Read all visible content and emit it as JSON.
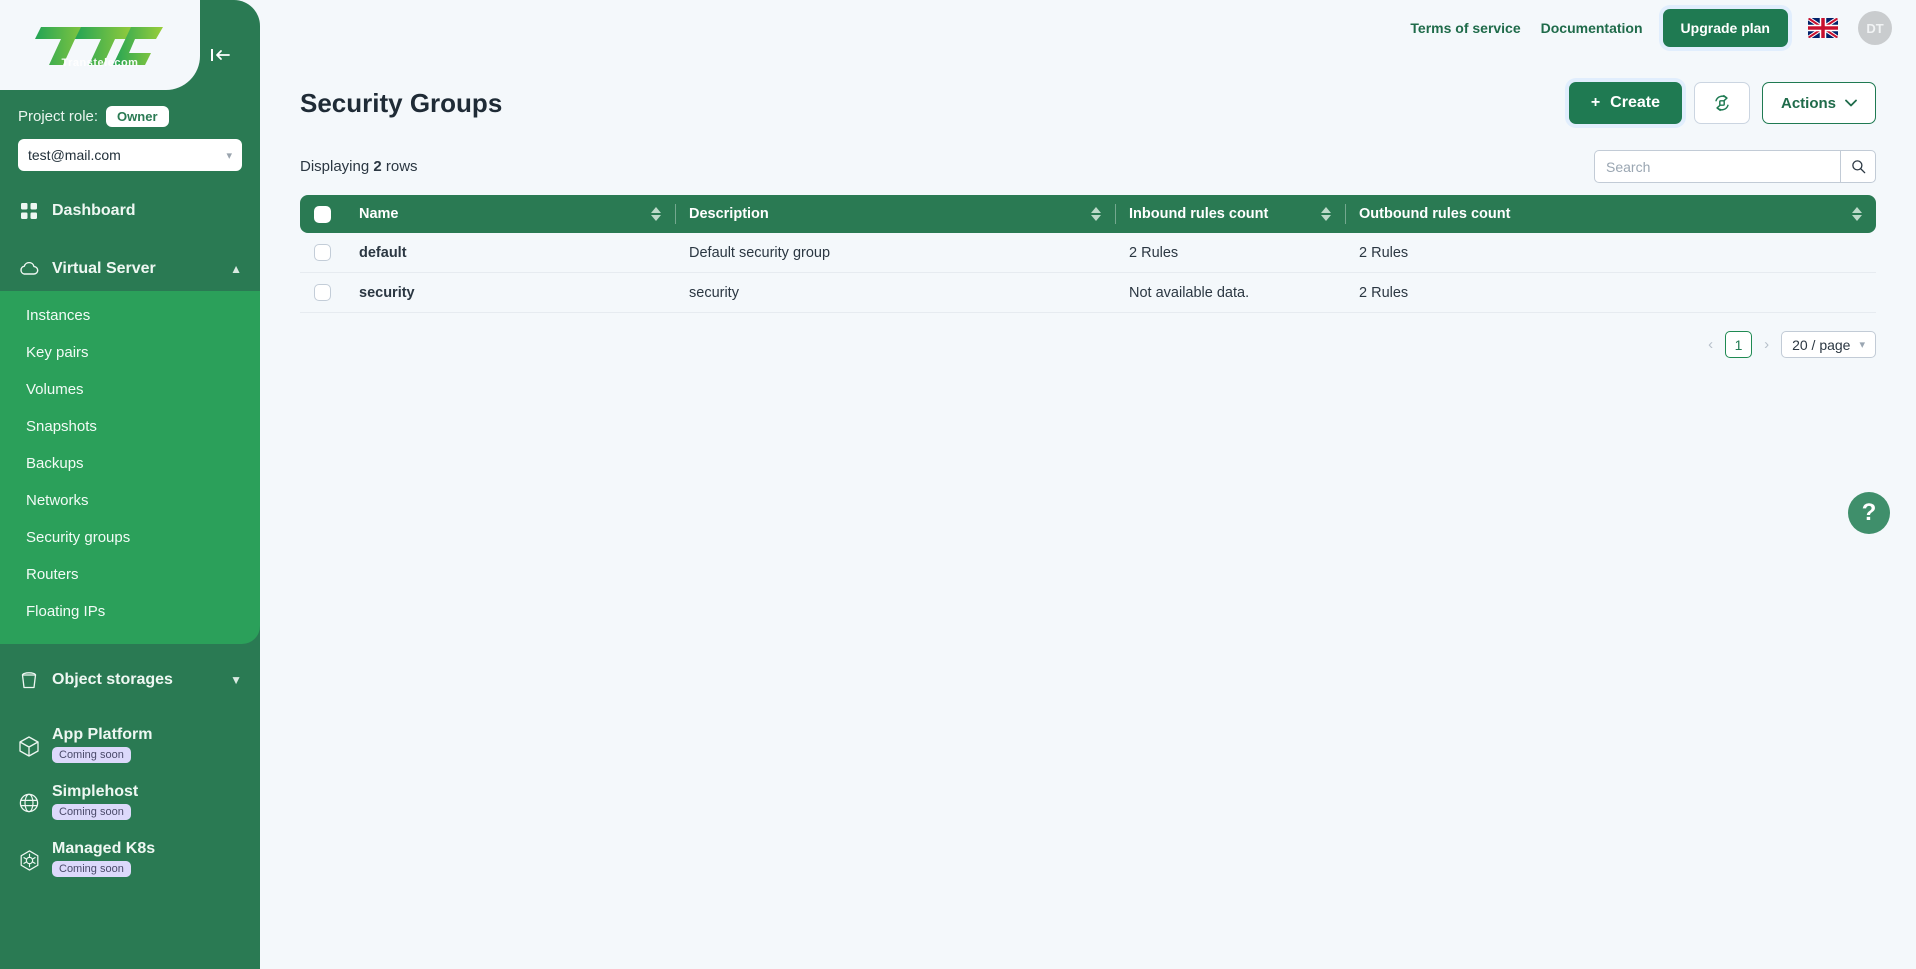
{
  "brand": {
    "logo_text": "TTC",
    "logo_sub": "Transtelecom",
    "collapse_icon": "collapse-left-icon",
    "green_dark": "#2a7a53",
    "green_mid": "#2ba05a",
    "green_btn": "#1f7a52",
    "link_green": "#1f8a52",
    "page_bg": "#f4f8fb",
    "badge_soon_bg": "#dcd9fb"
  },
  "sidebar": {
    "role_label": "Project role:",
    "role_badge": "Owner",
    "project_value": "test@mail.com",
    "nav": [
      {
        "label": "Dashboard",
        "icon": "grid-icon"
      },
      {
        "label": "Virtual Server",
        "icon": "cloud-icon",
        "chevron": "chevron-up-icon"
      }
    ],
    "submenu": [
      {
        "label": "Instances"
      },
      {
        "label": "Key pairs"
      },
      {
        "label": "Volumes"
      },
      {
        "label": "Snapshots"
      },
      {
        "label": "Backups"
      },
      {
        "label": "Networks"
      },
      {
        "label": "Security groups"
      },
      {
        "label": "Routers"
      },
      {
        "label": "Floating IPs"
      }
    ],
    "object_storages": {
      "label": "Object storages",
      "icon": "bucket-icon",
      "chevron": "chevron-down-icon"
    },
    "coming_soon": [
      {
        "label": "App Platform",
        "badge": "Coming soon",
        "icon": "cube-icon"
      },
      {
        "label": "Simplehost",
        "badge": "Coming soon",
        "icon": "globe-icon"
      },
      {
        "label": "Managed K8s",
        "badge": "Coming soon",
        "icon": "kubernetes-icon"
      }
    ]
  },
  "topbar": {
    "terms_link": "Terms of service",
    "documentation_link": "Documentation",
    "upgrade_button": "Upgrade plan",
    "flag": "uk-flag-icon",
    "avatar_initials": "DT"
  },
  "page": {
    "title": "Security Groups",
    "create_button": "Create",
    "create_plus": "+",
    "refresh_icon": "refresh-sync-icon",
    "actions_button": "Actions",
    "actions_chevron": "chevron-down-icon",
    "help_icon": "?"
  },
  "table": {
    "rows_info_prefix": "Displaying",
    "rows_info_count": "2",
    "rows_info_suffix": "rows",
    "search_placeholder": "Search",
    "search_value": "",
    "search_icon": "search-icon",
    "columns": [
      {
        "label": "Name"
      },
      {
        "label": "Description"
      },
      {
        "label": "Inbound rules count"
      },
      {
        "label": "Outbound rules count"
      }
    ],
    "rows": [
      {
        "name": "default",
        "description": "Default security group",
        "inbound": "2 Rules",
        "outbound": "2 Rules"
      },
      {
        "name": "security",
        "description": "security",
        "inbound": "Not available data.",
        "outbound": "2 Rules"
      }
    ]
  },
  "pagination": {
    "prev": "‹",
    "page": "1",
    "next": "›",
    "page_size": "20 / page"
  }
}
